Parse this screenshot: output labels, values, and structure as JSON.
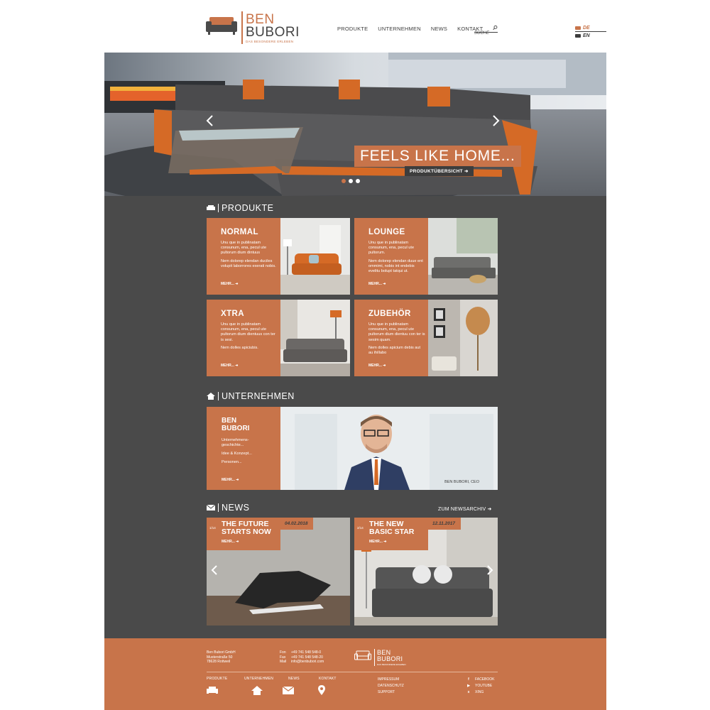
{
  "brand": {
    "name_line1": "BEN",
    "name_line2": "BUBORI",
    "tagline": "DAS BESONDERE ERLEBEN"
  },
  "nav": {
    "items": [
      "PRODUKTE",
      "UNTERNEHMEN",
      "NEWS",
      "KONTAKT"
    ],
    "search_placeholder": "SUCHE"
  },
  "languages": [
    "DE",
    "EN"
  ],
  "hero": {
    "headline": "FEELS LIKE HOME...",
    "cta": "PRODUKTÜBERSICHT ➜",
    "slides_count": 3,
    "active_slide": 1
  },
  "produkte": {
    "title": "PRODUKTE",
    "cards": [
      {
        "title": "NORMAL",
        "p1": "Unu que in publinatam consunum, ena, pecul ute pultorum dium dintuus",
        "p2": "Nem dolorep elendan duciles volupit laborrores exerati nobis.",
        "more": "MEHR... ➜"
      },
      {
        "title": "LOUNGE",
        "p1": "Unu que in publinatam consunum, ena, pecul ute pultorum.",
        "p2": "Nem dolorep elendan duue ent ommimi, nobis int endebis evelitu bolupt tatqui ut.",
        "more": "MEHR... ➜"
      },
      {
        "title": "XTRA",
        "p1": "Unu que in publinatam consunum, ena, pecul ute pultorum dium dientuus con ter is sesi.",
        "p2": "Nem dolles apiciubis.",
        "more": "MEHR... ➜"
      },
      {
        "title": "ZUBEHÖR",
        "p1": "Unu que in publinatam consunum, ena, pecul ute pultorum dium dientuu con ter is sesim quam.",
        "p2": "Nem dolles apicium debis aut au ihillabo",
        "more": "MEHR... ➜"
      }
    ]
  },
  "unternehmen": {
    "title": "UNTERNEHMEN",
    "card_title_1": "BEN",
    "card_title_2": "BUBORI",
    "links": [
      "Unternehmens-geschichte...",
      "Idee & Konzept...",
      "Personen..."
    ],
    "more": "MEHR... ➜",
    "caption": "BEN BUBORI, CEO"
  },
  "news": {
    "title": "NEWS",
    "archive_link": "ZUM NEWSARCHIV ➜",
    "items": [
      {
        "num": "1/14",
        "title_1": "THE FUTURE",
        "title_2": "STARTS NOW",
        "date": "04.02.2018",
        "more": "MEHR... ➜"
      },
      {
        "num": "2/14",
        "title_1": "THE NEW",
        "title_2": "BASIC STAR",
        "date": "12.11.2017",
        "more": "MEHR... ➜"
      }
    ]
  },
  "footer": {
    "address": [
      "Ben Bubori GmbH",
      "Musterstraße 50",
      "78628 Rottweil"
    ],
    "contact_labels": [
      "Fon",
      "Fax",
      "Mail"
    ],
    "contact_values": [
      "+49 741 548 548-0",
      "+49 741 548 548-20",
      "info@benbubori.com"
    ],
    "nav": [
      "PRODUKTE",
      "UNTERNEHMEN",
      "NEWS",
      "KONTAKT"
    ],
    "legal": [
      "IMPRESSUM",
      "DATENSCHUTZ",
      "SUPPORT"
    ],
    "social": [
      "FACEBOOK",
      "YOUTUBE",
      "XING"
    ],
    "social_icons": [
      "f",
      "▶",
      "x"
    ]
  },
  "colors": {
    "accent": "#c8744a",
    "dark": "#4a4a4a",
    "text_dark": "#3d3d3d"
  }
}
